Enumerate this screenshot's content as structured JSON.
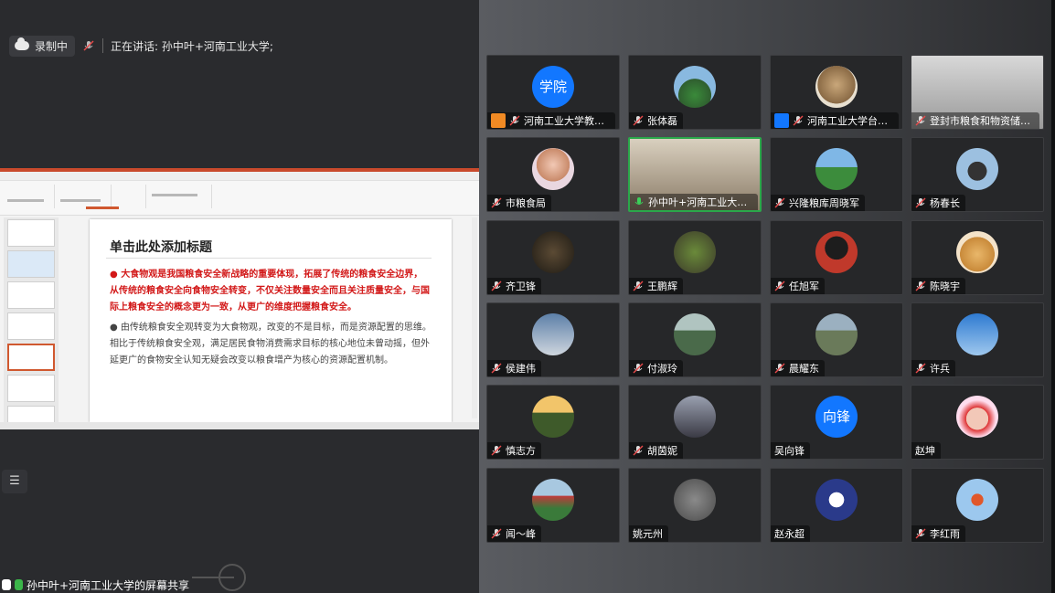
{
  "topbar": {
    "recording_label": "录制中",
    "speaking_label": "正在讲话: 孙中叶+河南工业大学;"
  },
  "slide": {
    "title": "单击此处添加标题",
    "bullet1": "大食物观是我国粮食安全新战略的重要体现，拓展了传统的粮食安全边界，从传统的粮食安全向食物安全转变，不仅关注数量安全而且关注质量安全，与国际上粮食安全的概念更为一致，从更广的维度把握粮食安全。",
    "bullet2": "由传统粮食安全观转变为大食物观，改变的不是目标，而是资源配置的思维。相比于传统粮食安全观，满足居民食物消费需求目标的核心地位未曾动摇，但外延更广的食物安全认知无疑会改变以粮食增产为核心的资源配置机制。"
  },
  "share_bar": {
    "label": "孙中叶+河南工业大学的屏幕共享"
  },
  "colors": {
    "accent_green": "#2aa84a",
    "avatar_blue": "#1277ff",
    "title_red": "#d21818"
  },
  "participants": [
    {
      "name": "河南工业大学教育培...",
      "avatar_text": "学院",
      "tag": "orange"
    },
    {
      "name": "张体磊",
      "avatar_icon": "landscape-photo"
    },
    {
      "name": "河南工业大学台家栋",
      "avatar_icon": "teddy-bear-photo",
      "tag": "blue"
    },
    {
      "name": "登封市粮食和物资储备局...",
      "avatar_icon": "ceiling-video"
    },
    {
      "name": "市粮食局",
      "avatar_icon": "cartoon-girl-photo"
    },
    {
      "name": "孙中叶+河南工业大学...",
      "avatar_icon": "live-video",
      "speaking": true
    },
    {
      "name": "兴隆粮库周晓军",
      "avatar_icon": "green-hills-photo"
    },
    {
      "name": "杨春长",
      "avatar_icon": "man-photo"
    },
    {
      "name": "齐卫锋",
      "avatar_icon": "dark-scene-photo"
    },
    {
      "name": "王鹏辉",
      "avatar_icon": "plant-photo"
    },
    {
      "name": "任旭军",
      "avatar_icon": "portrait-photo"
    },
    {
      "name": "陈晓宇",
      "avatar_icon": "dog-photo"
    },
    {
      "name": "侯建伟",
      "avatar_icon": "girl-sky-photo"
    },
    {
      "name": "付淑玲",
      "avatar_icon": "valley-photo"
    },
    {
      "name": "晨耀东",
      "avatar_icon": "mountain-photo"
    },
    {
      "name": "许兵",
      "avatar_icon": "blue-sky-photo"
    },
    {
      "name": "慎志方",
      "avatar_icon": "tree-photo"
    },
    {
      "name": "胡茵妮",
      "avatar_icon": "silhouette-photo"
    },
    {
      "name": "吴向锋",
      "avatar_text": "向锋",
      "no_mic": true
    },
    {
      "name": "赵坤",
      "avatar_icon": "child-photo",
      "no_mic": true
    },
    {
      "name": "闻～峰",
      "avatar_icon": "garden-photo"
    },
    {
      "name": "姚元州",
      "avatar_icon": "rocks-photo",
      "no_mic": true
    },
    {
      "name": "赵永超",
      "avatar_icon": "snowman-photo",
      "no_mic": true
    },
    {
      "name": "李红雨",
      "avatar_icon": "flowers-photo"
    }
  ]
}
